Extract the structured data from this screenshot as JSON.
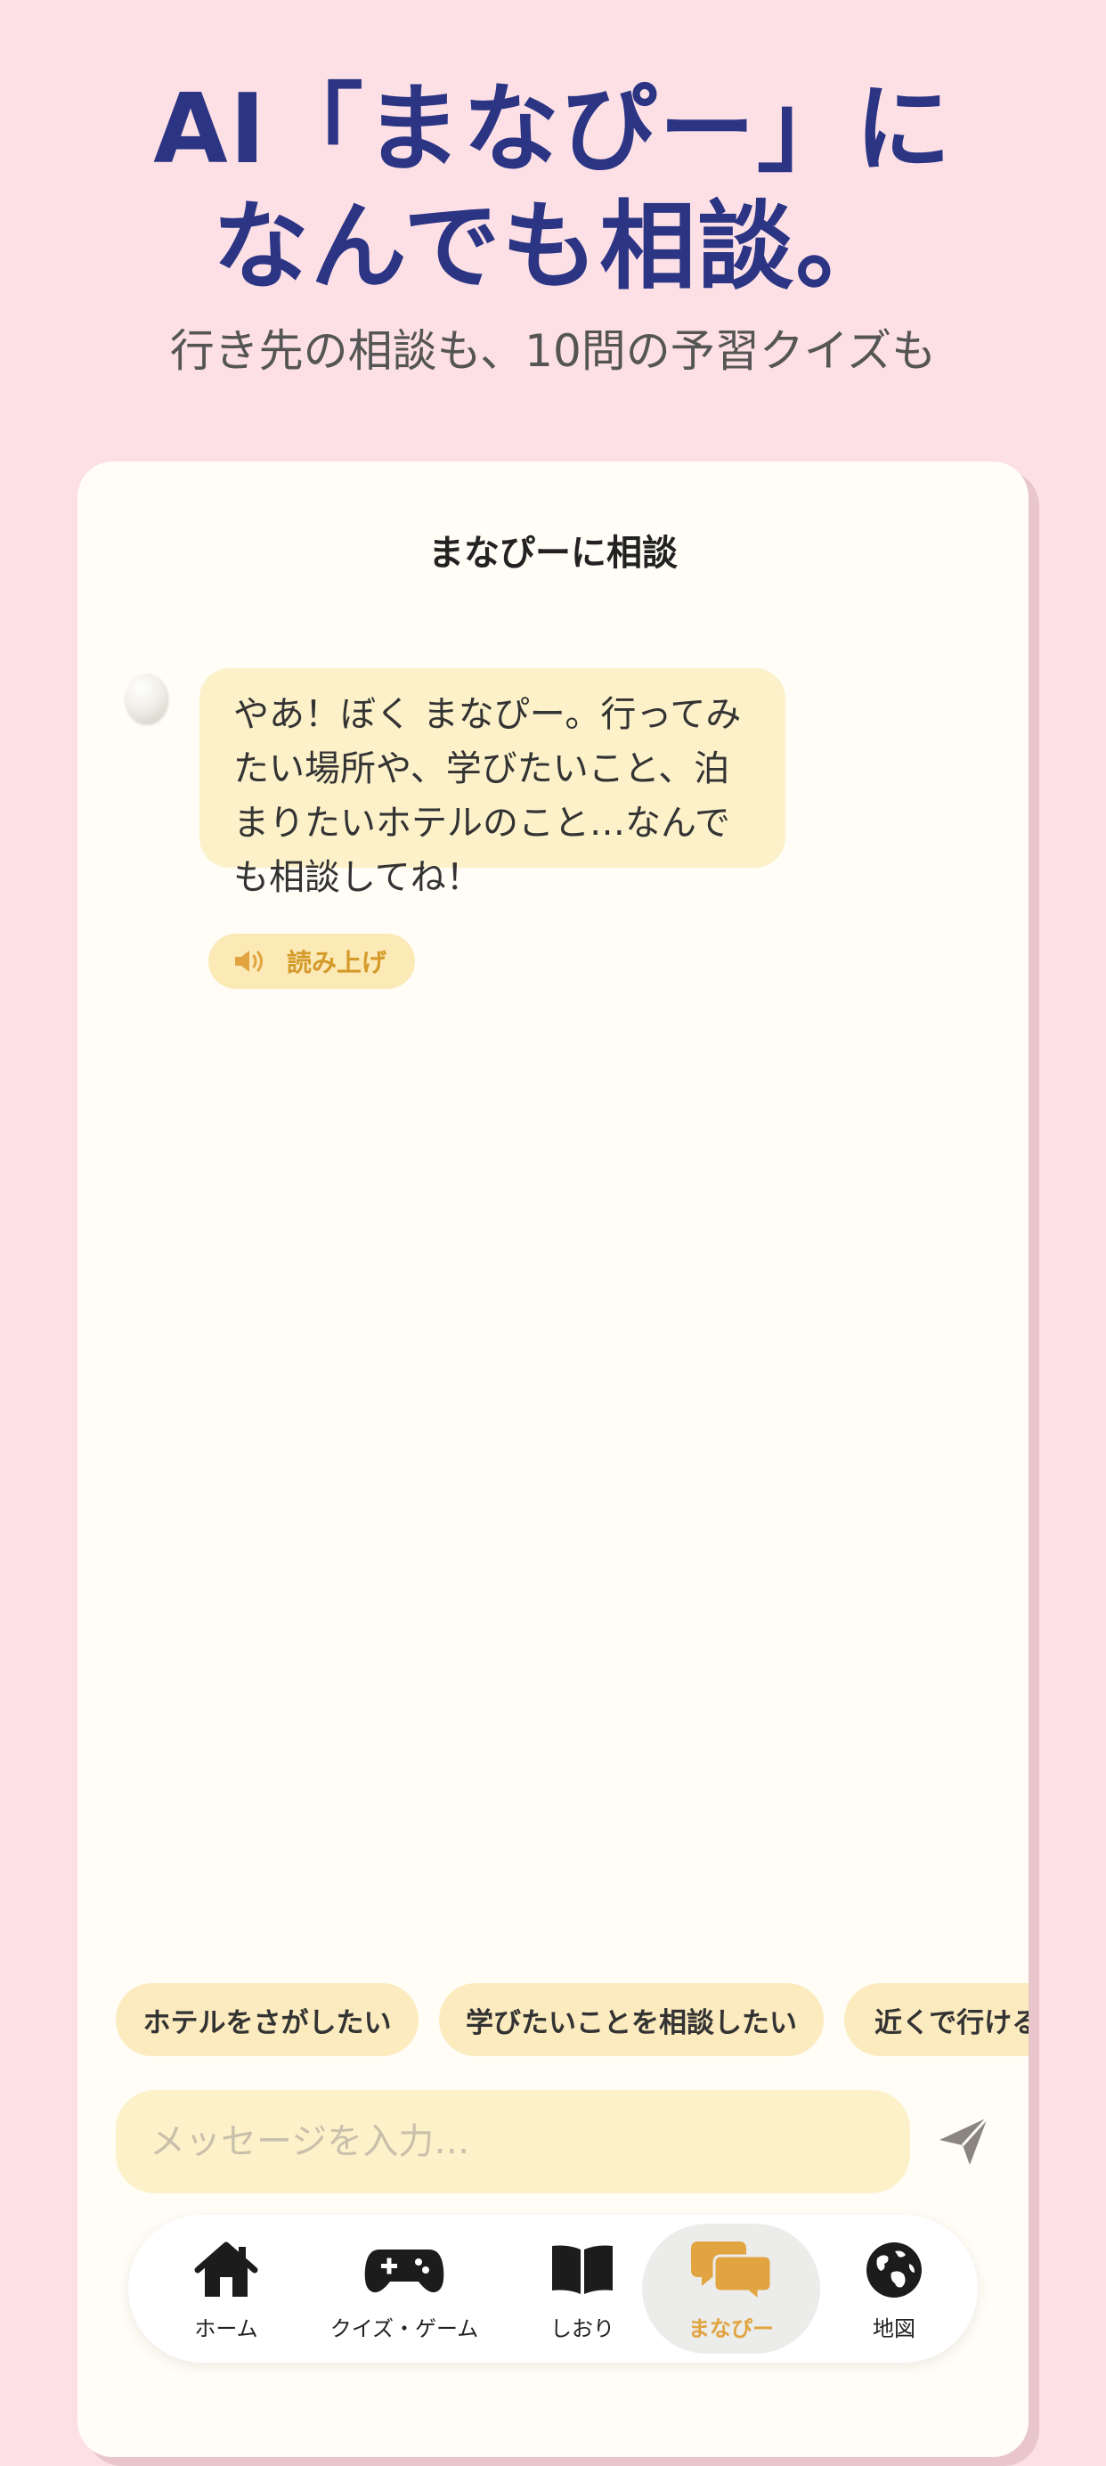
{
  "hero": {
    "title_line1": "AI「まなぴー」に",
    "title_line2": "なんでも相談。",
    "subtitle": "行き先の相談も、10問の予習クイズも"
  },
  "screen": {
    "title": "まなぴーに相談"
  },
  "chat": {
    "message": "やあ！ぼく まなぴー。行ってみたい場所や、学びたいこと、泊まりたいホテルのこと…なんでも相談してね！",
    "read_aloud_label": "読み上げ"
  },
  "suggestions": [
    {
      "label": "ホテルをさがしたい"
    },
    {
      "label": "学びたいことを相談したい"
    },
    {
      "label": "近くで行ける"
    }
  ],
  "input": {
    "placeholder": "メッセージを入力…"
  },
  "tabs": [
    {
      "label": "ホーム",
      "icon": "home-icon"
    },
    {
      "label": "クイズ・ゲーム",
      "icon": "gamepad-icon"
    },
    {
      "label": "しおり",
      "icon": "book-icon"
    },
    {
      "label": "まなぴー",
      "icon": "chat-bubbles-icon",
      "active": true
    },
    {
      "label": "地図",
      "icon": "globe-icon"
    }
  ],
  "colors": {
    "background": "#fde0e6",
    "title": "#2b3584",
    "accent": "#e1a441",
    "bubble": "#fcf1c9"
  }
}
